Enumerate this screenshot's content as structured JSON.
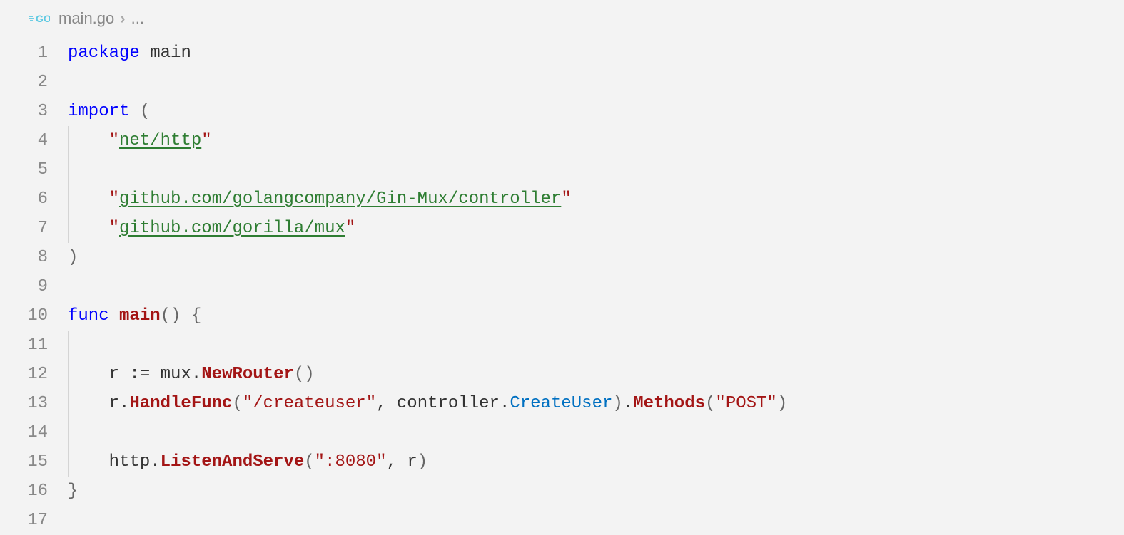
{
  "breadcrumb": {
    "filename": "main.go",
    "tail": "..."
  },
  "gutter": {
    "start": 1,
    "end": 17
  },
  "code": {
    "l1": {
      "kw": "package",
      "sp": " ",
      "id": "main"
    },
    "l3": {
      "kw": "import",
      "sp": " ",
      "p": "("
    },
    "l4": {
      "q1": "\"",
      "s": "net/http",
      "q2": "\""
    },
    "l6": {
      "q1": "\"",
      "s": "github.com/golangcompany/Gin-Mux/controller",
      "q2": "\""
    },
    "l7": {
      "q1": "\"",
      "s": "github.com/gorilla/mux",
      "q2": "\""
    },
    "l8": {
      "p": ")"
    },
    "l10": {
      "kw": "func",
      "sp": " ",
      "fn": "main",
      "p1": "()",
      "sp2": " ",
      "b": "{"
    },
    "l12": {
      "v": "r",
      "sp": " ",
      "op": ":=",
      "sp2": " ",
      "pkg": "mux",
      "dot": ".",
      "fn": "NewRouter",
      "p": "()"
    },
    "l13": {
      "v": "r",
      "dot": ".",
      "fn1": "HandleFunc",
      "p1": "(",
      "s1": "\"/createuser\"",
      "c": ",",
      "sp": " ",
      "pkg": "controller",
      "dot2": ".",
      "mem": "CreateUser",
      "p2": ")",
      "dot3": ".",
      "fn2": "Methods",
      "p3": "(",
      "s2": "\"POST\"",
      "p4": ")"
    },
    "l15": {
      "pkg": "http",
      "dot": ".",
      "fn": "ListenAndServe",
      "p1": "(",
      "s": "\":8080\"",
      "c": ",",
      "sp": " ",
      "v": "r",
      "p2": ")"
    },
    "l16": {
      "b": "}"
    }
  }
}
